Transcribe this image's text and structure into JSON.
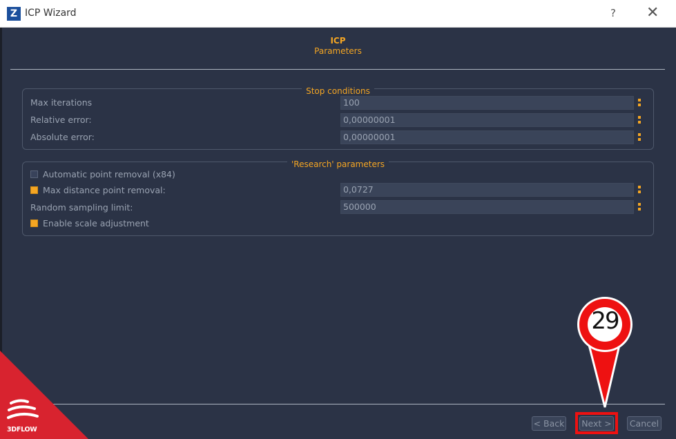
{
  "window": {
    "app_logo_letter": "Z",
    "title": "ICP Wizard",
    "help_label": "?",
    "close_label": "✕"
  },
  "header": {
    "title": "ICP",
    "subtitle": "Parameters"
  },
  "stop_conditions": {
    "title": "Stop conditions",
    "rows": [
      {
        "label": "Max iterations",
        "value": "100"
      },
      {
        "label": "Relative error:",
        "value": "0,00000001"
      },
      {
        "label": "Absolute error:",
        "value": "0,00000001"
      }
    ]
  },
  "research": {
    "title": "'Research' parameters",
    "auto_removal": {
      "label": "Automatic point removal (x84)",
      "checked": false
    },
    "max_distance": {
      "label": "Max distance point removal:",
      "checked": true,
      "value": "0,0727"
    },
    "sampling": {
      "label": "Random sampling limit:",
      "value": "500000"
    },
    "scale_adjust": {
      "label": "Enable scale adjustment",
      "checked": true
    }
  },
  "footer": {
    "back_label": "< Back",
    "next_label": "Next >",
    "cancel_label": "Cancel"
  },
  "callout": {
    "number": "29",
    "color": "#ee1111"
  },
  "watermark": {
    "brand": "3DFLOW",
    "color": "#d8232f"
  },
  "colors": {
    "accent": "#f5a623",
    "background": "#2b3346"
  }
}
